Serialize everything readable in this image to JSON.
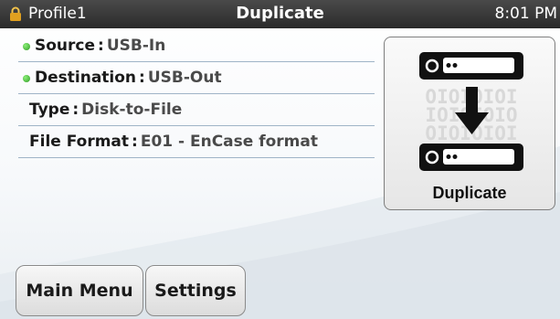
{
  "status_bar": {
    "profile": "Profile1",
    "title": "Duplicate",
    "time": "8:01 PM"
  },
  "info": {
    "source": {
      "label": "Source",
      "separator": ":",
      "value": "USB-In",
      "status_color": "#3cb02a"
    },
    "destination": {
      "label": "Destination",
      "separator": ":",
      "value": "USB-Out",
      "status_color": "#3cb02a"
    },
    "type": {
      "label": "Type",
      "separator": ":",
      "value": "Disk-to-File"
    },
    "file_format": {
      "label": "File Format",
      "separator": ":",
      "value": "E01 - EnCase format"
    }
  },
  "duplicate_button": {
    "label": "Duplicate",
    "icon": "disk-duplicate-icon",
    "binary_text": [
      "OIOIOIOI",
      "IOIOIOIO",
      "OIOIOIOI"
    ]
  },
  "bottom_buttons": {
    "main_menu": "Main Menu",
    "settings": "Settings"
  },
  "colors": {
    "status_bar": "#333333",
    "accent_divider": "#9fb4c7",
    "status_ok": "#3cb02a",
    "lock": "#e0a020"
  }
}
